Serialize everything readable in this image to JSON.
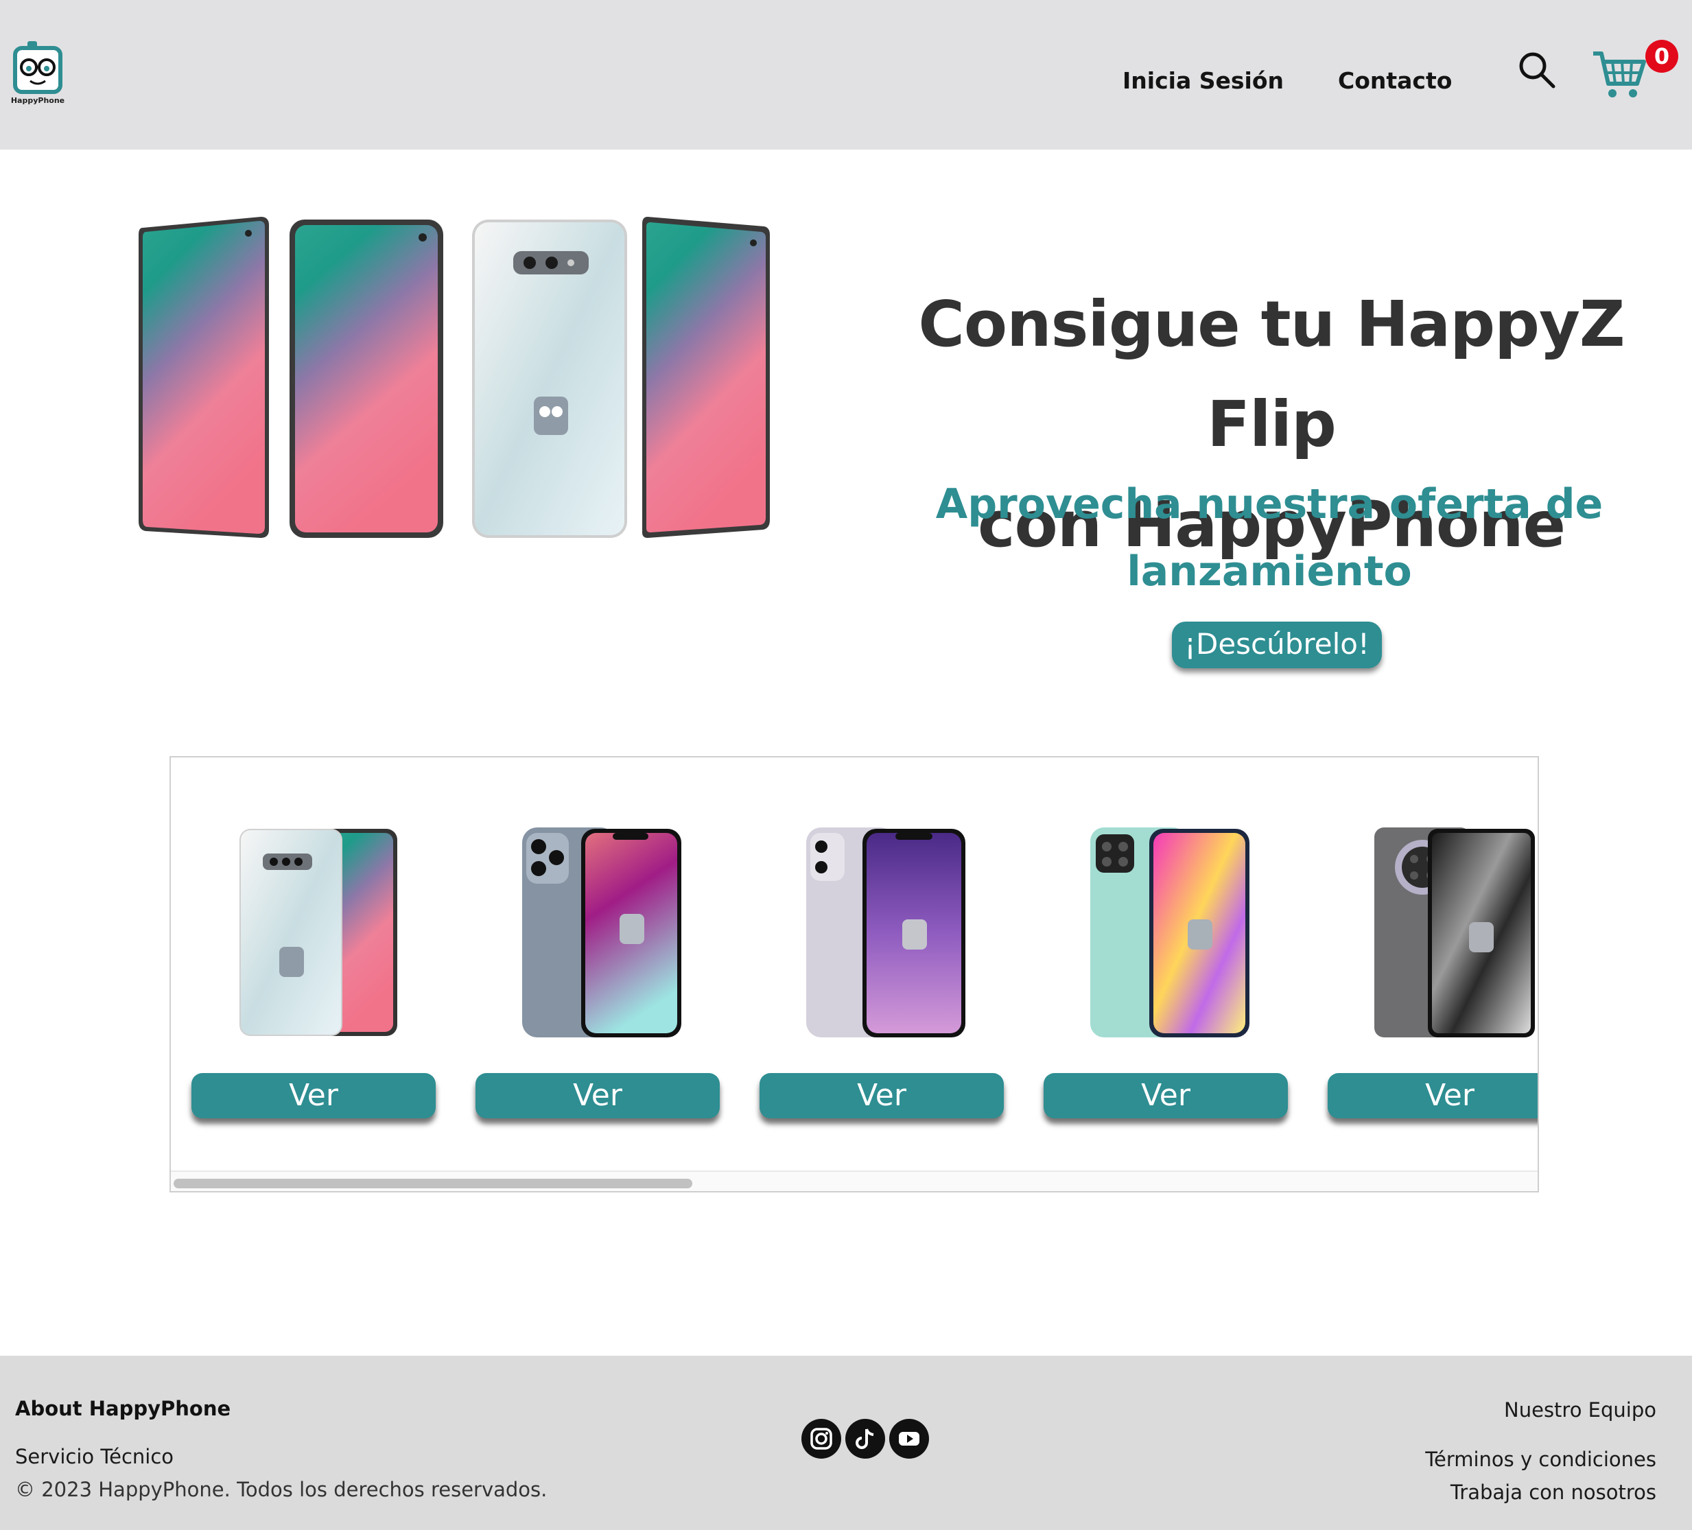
{
  "header": {
    "logo_text": "HappyPhone",
    "nav": {
      "login": "Inicia Sesión",
      "contact": "Contacto"
    },
    "cart_count": "0",
    "icons": [
      "search-icon",
      "cart-icon"
    ]
  },
  "hero": {
    "title_line1": "Consigue tu HappyZ Flip",
    "title_line2": "con HappyPhone",
    "subtitle_line1": "Aprovecha nuestra oferta de",
    "subtitle_line2": "lanzamiento",
    "cta": "¡Descúbrelo!"
  },
  "products": [
    {
      "button": "Ver"
    },
    {
      "button": "Ver"
    },
    {
      "button": "Ver"
    },
    {
      "button": "Ver"
    },
    {
      "button": "Ver"
    }
  ],
  "footer": {
    "about": "About HappyPhone",
    "service": "Servicio Técnico",
    "copyright": "© 2023 HappyPhone. Todos los derechos reservados.",
    "team": "Nuestro Equipo",
    "terms": "Términos y condiciones",
    "work": "Trabaja con nosotros",
    "social": [
      "instagram-icon",
      "tiktok-icon",
      "youtube-icon"
    ]
  },
  "colors": {
    "accent": "#2e8e92",
    "header_bg": "#e1e1e3",
    "footer_bg": "#dbdbdb",
    "badge": "#e2091b",
    "title": "#333333"
  }
}
